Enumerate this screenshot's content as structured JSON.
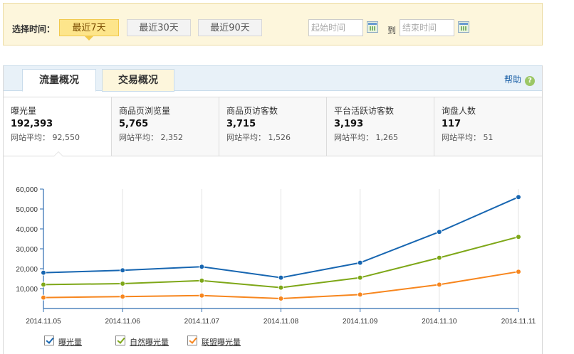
{
  "filter": {
    "label": "选择时间：",
    "ranges": [
      "最近7天",
      "最近30天",
      "最近90天"
    ],
    "start_placeholder": "起始时间",
    "to_label": "到",
    "end_placeholder": "结束时间"
  },
  "tabs": [
    "流量概况",
    "交易概况"
  ],
  "help_label": "帮助",
  "metrics": [
    {
      "label": "曝光量",
      "value": "192,393",
      "avg": "网站平均： 92,550"
    },
    {
      "label": "商品页浏览量",
      "value": "5,765",
      "avg": "网站平均： 2,352"
    },
    {
      "label": "商品页访客数",
      "value": "3,715",
      "avg": "网站平均： 1,526"
    },
    {
      "label": "平台活跃访客数",
      "value": "3,193",
      "avg": "网站平均： 1,265"
    },
    {
      "label": "询盘人数",
      "value": "117",
      "avg": "网站平均： 51"
    }
  ],
  "chart_data": {
    "type": "line",
    "title": "",
    "xlabel": "",
    "ylabel": "",
    "categories": [
      "2014.11.05",
      "2014.11.06",
      "2014.11.07",
      "2014.11.08",
      "2014.11.09",
      "2014.11.10",
      "2014.11.11"
    ],
    "ylim": [
      0,
      60000
    ],
    "yticks": [
      10000,
      20000,
      30000,
      40000,
      50000,
      60000
    ],
    "ytick_labels": [
      "10,000",
      "20,000",
      "30,000",
      "40,000",
      "50,000",
      "60,000"
    ],
    "grid": "vertical",
    "legend_position": "bottom-left",
    "series": [
      {
        "name": "曝光量",
        "color": "#1766b1",
        "values": [
          18000,
          19200,
          21000,
          15500,
          23000,
          38500,
          56000
        ]
      },
      {
        "name": "自然曝光量",
        "color": "#7ea718",
        "values": [
          12000,
          12500,
          14000,
          10500,
          15500,
          25500,
          36000
        ]
      },
      {
        "name": "联盟曝光量",
        "color": "#f7861e",
        "values": [
          5500,
          6000,
          6500,
          5000,
          7000,
          12000,
          18500
        ]
      }
    ]
  }
}
